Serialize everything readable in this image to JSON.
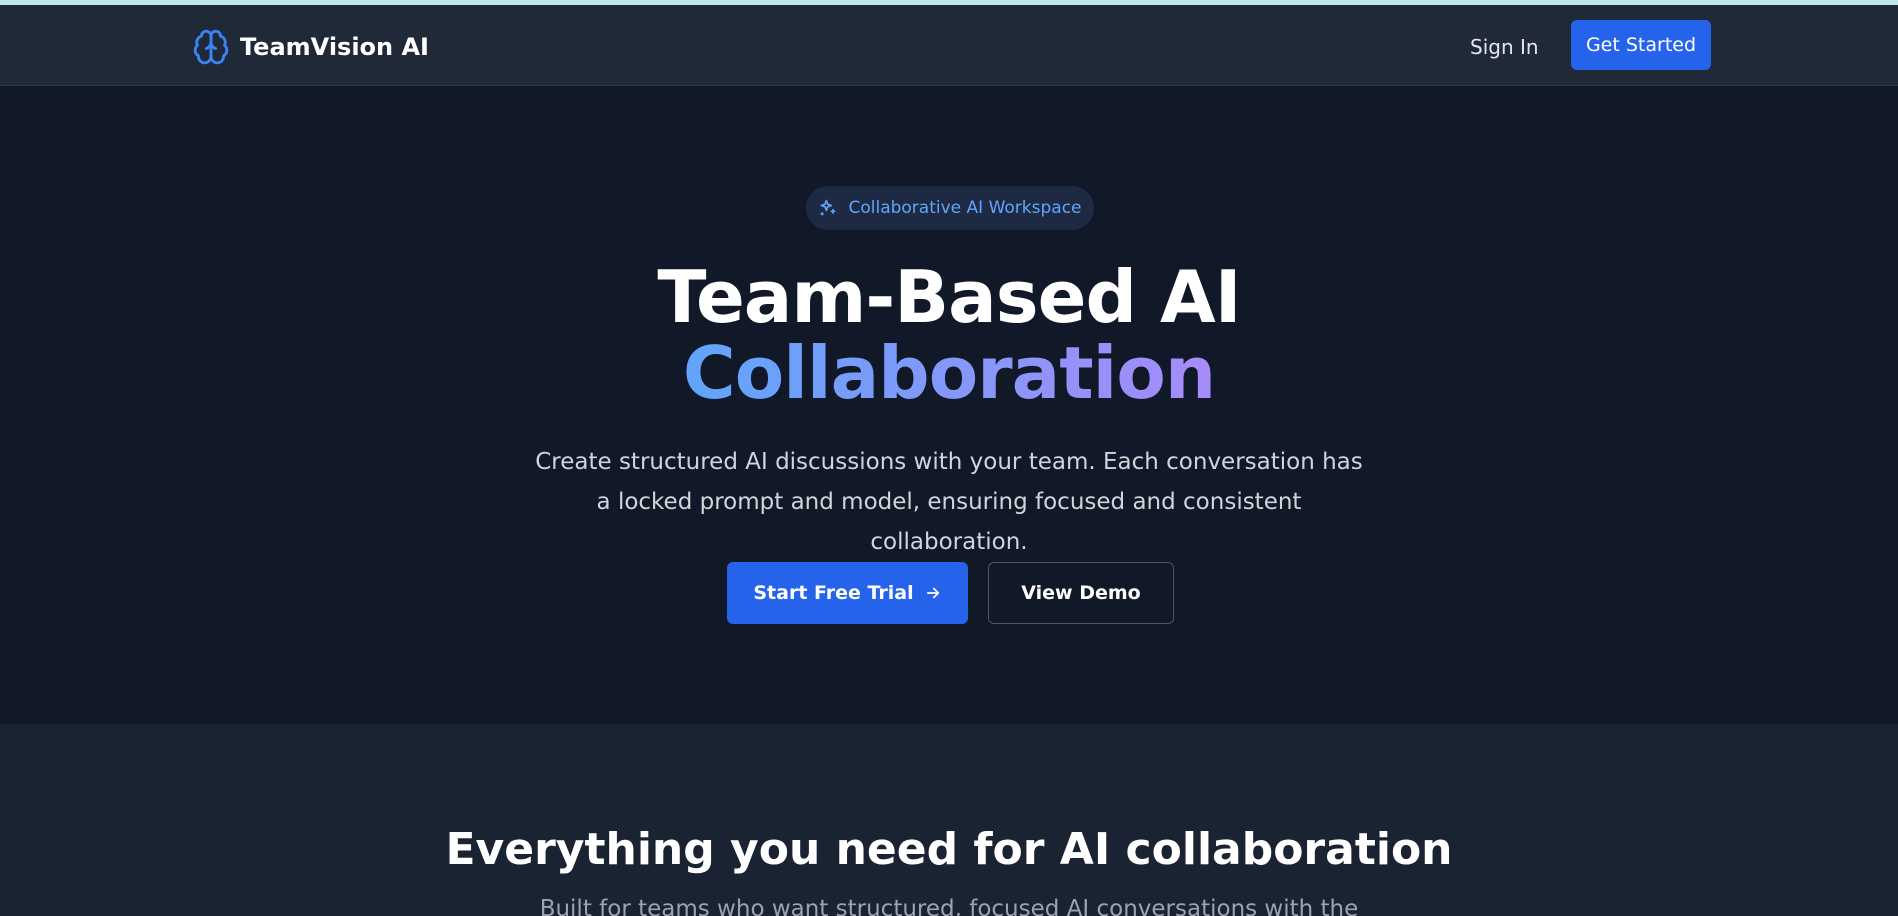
{
  "navbar": {
    "brand_name": "TeamVision AI",
    "brand_icon": "brain-icon",
    "sign_in_label": "Sign In",
    "get_started_label": "Get Started"
  },
  "hero": {
    "badge_icon": "sparkles-icon",
    "badge_text": "Collaborative AI Workspace",
    "title_line_1": "Team-Based AI",
    "title_line_2": "Collaboration",
    "subtitle": "Create structured AI discussions with your team. Each conversation has a locked prompt and model, ensuring focused and consistent collaboration.",
    "primary_cta_label": "Start Free Trial",
    "primary_cta_icon": "arrow-right-icon",
    "secondary_cta_label": "View Demo"
  },
  "features": {
    "title": "Everything you need for AI collaboration",
    "subtitle": "Built for teams who want structured, focused AI conversations with the"
  },
  "colors": {
    "background": "#111827",
    "navbar": "#1f2937",
    "accent": "#2563eb",
    "badge_text": "#60a5fa",
    "gradient_start": "#60a5fa",
    "gradient_end": "#a78bfa"
  }
}
